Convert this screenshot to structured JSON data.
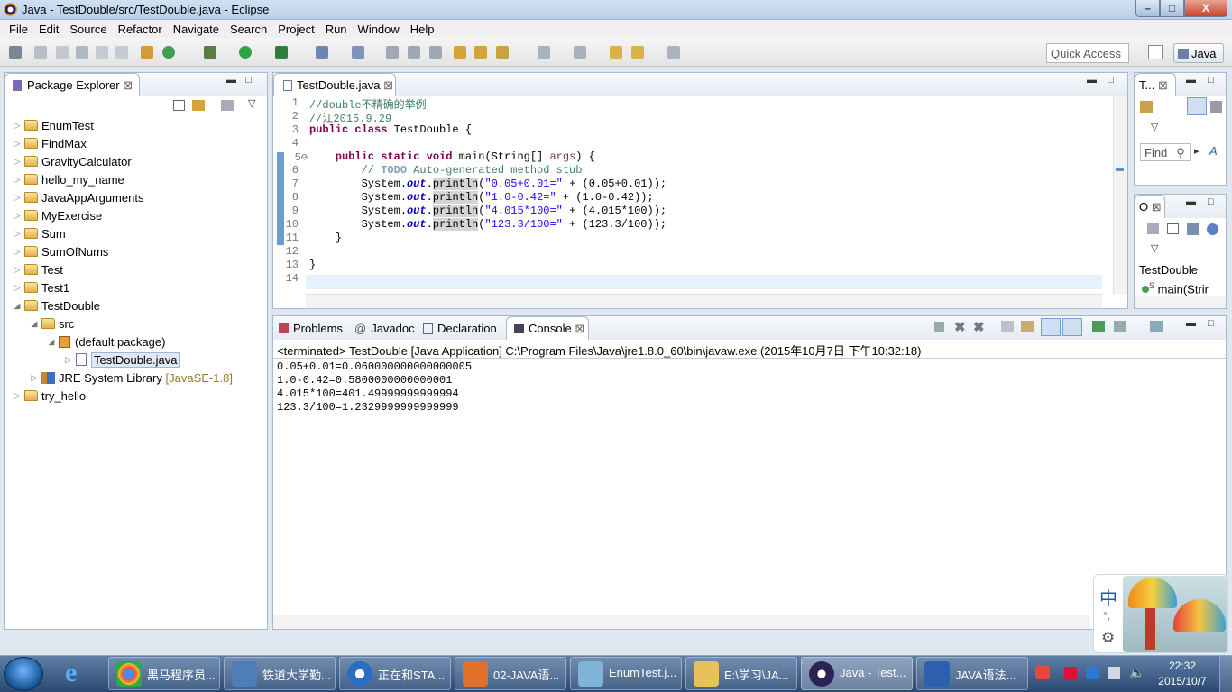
{
  "window": {
    "title": "Java - TestDouble/src/TestDouble.java - Eclipse",
    "min": "–",
    "max": "□",
    "close": "X"
  },
  "menu": [
    "File",
    "Edit",
    "Source",
    "Refactor",
    "Navigate",
    "Search",
    "Project",
    "Run",
    "Window",
    "Help"
  ],
  "toolbar": {
    "quick_access": "Quick Access",
    "perspective": "Java"
  },
  "package_explorer": {
    "title": "Package Explorer",
    "items": [
      {
        "label": "EnumTest"
      },
      {
        "label": "FindMax"
      },
      {
        "label": "GravityCalculator"
      },
      {
        "label": "hello_my_name"
      },
      {
        "label": "JavaAppArguments"
      },
      {
        "label": "MyExercise"
      },
      {
        "label": "Sum"
      },
      {
        "label": "SumOfNums"
      },
      {
        "label": "Test"
      },
      {
        "label": "Test1"
      },
      {
        "label": "TestDouble"
      },
      {
        "label": "src"
      },
      {
        "label": "(default package)"
      },
      {
        "label": "TestDouble.java"
      },
      {
        "label": "JRE System Library",
        "suffix": "[JavaSE-1.8]"
      },
      {
        "label": "try_hello"
      }
    ]
  },
  "editor": {
    "tab": "TestDouble.java",
    "line_numbers": [
      "1",
      "2",
      "3",
      "4",
      "5⊖",
      "6",
      "7",
      "8",
      "9",
      "10",
      "11",
      "12",
      "13",
      "14"
    ],
    "lines": {
      "l1": "//double不精确的举例",
      "l2": "//江2015.9.29",
      "l3a": "public class",
      "l3b": " TestDouble {",
      "l5a": "    public static void",
      "l5b": " main(String[] ",
      "l5c": "args",
      "l5d": ") {",
      "l6a": "        // ",
      "l6b": "TODO",
      "l6c": " Auto-generated method stub",
      "sys": "        System.",
      "out": "out",
      "dot": ".",
      "println": "println",
      "l7s": "\"0.05+0.01=\"",
      "l7e": " + (0.05+0.01));",
      "l8s": "\"1.0-0.42=\"",
      "l8e": " + (1.0-0.42));",
      "l9s": "\"4.015*100=\"",
      "l9e": " + (4.015*100));",
      "l10s": "\"123.3/100=\"",
      "l10e": " + (123.3/100));",
      "l11": "    }",
      "l13": "}"
    }
  },
  "bottom_tabs": {
    "problems": "Problems",
    "javadoc": "Javadoc",
    "declaration": "Declaration",
    "console": "Console"
  },
  "console": {
    "header": "<terminated> TestDouble [Java Application] C:\\Program Files\\Java\\jre1.8.0_60\\bin\\javaw.exe (2015年10月7日 下午10:32:18)",
    "output": [
      "0.05+0.01=0.060000000000000005",
      "1.0-0.42=0.5800000000000001",
      "4.015*100=401.49999999999994",
      "123.3/100=1.2329999999999999"
    ]
  },
  "task_list": {
    "tab": "T...",
    "find": "Find",
    "all": "A"
  },
  "outline": {
    "tab": "O",
    "class": "TestDouble",
    "method": "main(Strir",
    "method_mark": "S"
  },
  "ime": {
    "char": "中",
    "punct": "°,"
  },
  "taskbar": {
    "items": [
      "黑马程序员...",
      "铁道大学勤...",
      "正在和STA...",
      "02-JAVA语...",
      "EnumTest.j...",
      "E:\\学习\\JA...",
      "Java - Test...",
      "JAVA语法..."
    ],
    "time": "22:32",
    "date": "2015/10/7",
    "colors": [
      "#e8473b",
      "#4f7db8",
      "#2b6cc4",
      "#e0702a",
      "#7fb3d9",
      "#e7c25a",
      "#2c2255",
      "#2b5faf"
    ]
  }
}
